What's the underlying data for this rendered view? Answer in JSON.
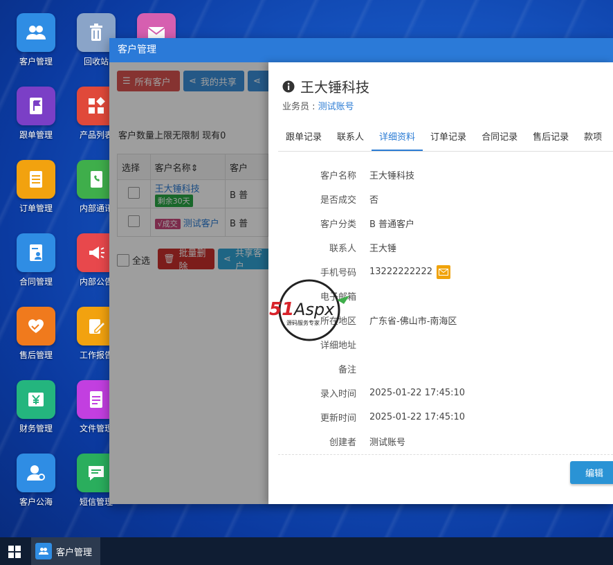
{
  "desktop": {
    "icons": [
      {
        "label": "客户管理",
        "color": "#2f8de4",
        "icon": "users-icon"
      },
      {
        "label": "回收站",
        "color": "#8aa4c8",
        "icon": "trash-icon"
      },
      {
        "label": "",
        "color": "#d65fb0",
        "icon": "mail-icon"
      },
      {
        "label": "跟单管理",
        "color": "#7b3fc6",
        "icon": "flag-notebook-icon"
      },
      {
        "label": "产品列表",
        "color": "#e0493a",
        "icon": "grid-icon"
      },
      {
        "label": "订单管理",
        "color": "#f2a20f",
        "icon": "document-icon"
      },
      {
        "label": "内部通讯",
        "color": "#3fae4b",
        "icon": "phone-book-icon"
      },
      {
        "label": "合同管理",
        "color": "#2f8de4",
        "icon": "contract-icon"
      },
      {
        "label": "内部公告",
        "color": "#e8484c",
        "icon": "megaphone-icon"
      },
      {
        "label": "售后管理",
        "color": "#f07a1d",
        "icon": "handshake-icon"
      },
      {
        "label": "工作报告",
        "color": "#f2a20f",
        "icon": "report-edit-icon"
      },
      {
        "label": "财务管理",
        "color": "#24b57e",
        "icon": "yen-icon"
      },
      {
        "label": "文件管理",
        "color": "#c23fe0",
        "icon": "file-icon"
      },
      {
        "label": "客户公海",
        "color": "#2f8de4",
        "icon": "user-pool-icon"
      },
      {
        "label": "短信管理",
        "color": "#2aae5d",
        "icon": "sms-icon"
      }
    ]
  },
  "window": {
    "title": "客户管理",
    "list": {
      "btn_all": "所有客户",
      "btn_my_share": "我的共享",
      "btn_third": "",
      "limit_text": "客户数量上限无限制 现有0",
      "columns": [
        "选择",
        "客户名称",
        "客户"
      ],
      "rows": [
        {
          "name": "王大锤科技",
          "tag": "剩余30天",
          "cat": "B 普"
        },
        {
          "name": "测试客户",
          "tag": "√成交",
          "cat": "B 普"
        }
      ],
      "select_all": "全选",
      "btn_batch_delete": "批量删除",
      "btn_share_customer": "共享客户"
    },
    "detail": {
      "title": "王大锤科技",
      "salesman_label": "业务员 :",
      "salesman_value": "测试账号",
      "tabs": [
        "跟单记录",
        "联系人",
        "详细资料",
        "订单记录",
        "合同记录",
        "售后记录",
        "款项"
      ],
      "active_tab": 2,
      "fields": [
        {
          "key": "客户名称",
          "value": "王大锤科技"
        },
        {
          "key": "是否成交",
          "value": "否"
        },
        {
          "key": "客户分类",
          "value": "B 普通客户"
        },
        {
          "key": "联系人",
          "value": "王大锤"
        },
        {
          "key": "手机号码",
          "value": "13222222222"
        },
        {
          "key": "电子邮箱",
          "value": ""
        },
        {
          "key": "所在地区",
          "value": "广东省-佛山市-南海区"
        },
        {
          "key": "详细地址",
          "value": ""
        },
        {
          "key": "备注",
          "value": ""
        },
        {
          "key": "录入时间",
          "value": "2025-01-22 17:45:10"
        },
        {
          "key": "更新时间",
          "value": "2025-01-22 17:45:10"
        },
        {
          "key": "创建者",
          "value": "测试账号"
        }
      ],
      "edit_label": "编辑"
    }
  },
  "watermark": {
    "brand": "51Aspx",
    "tagline": "源码服务专家"
  },
  "taskbar": {
    "task_label": "客户管理"
  }
}
